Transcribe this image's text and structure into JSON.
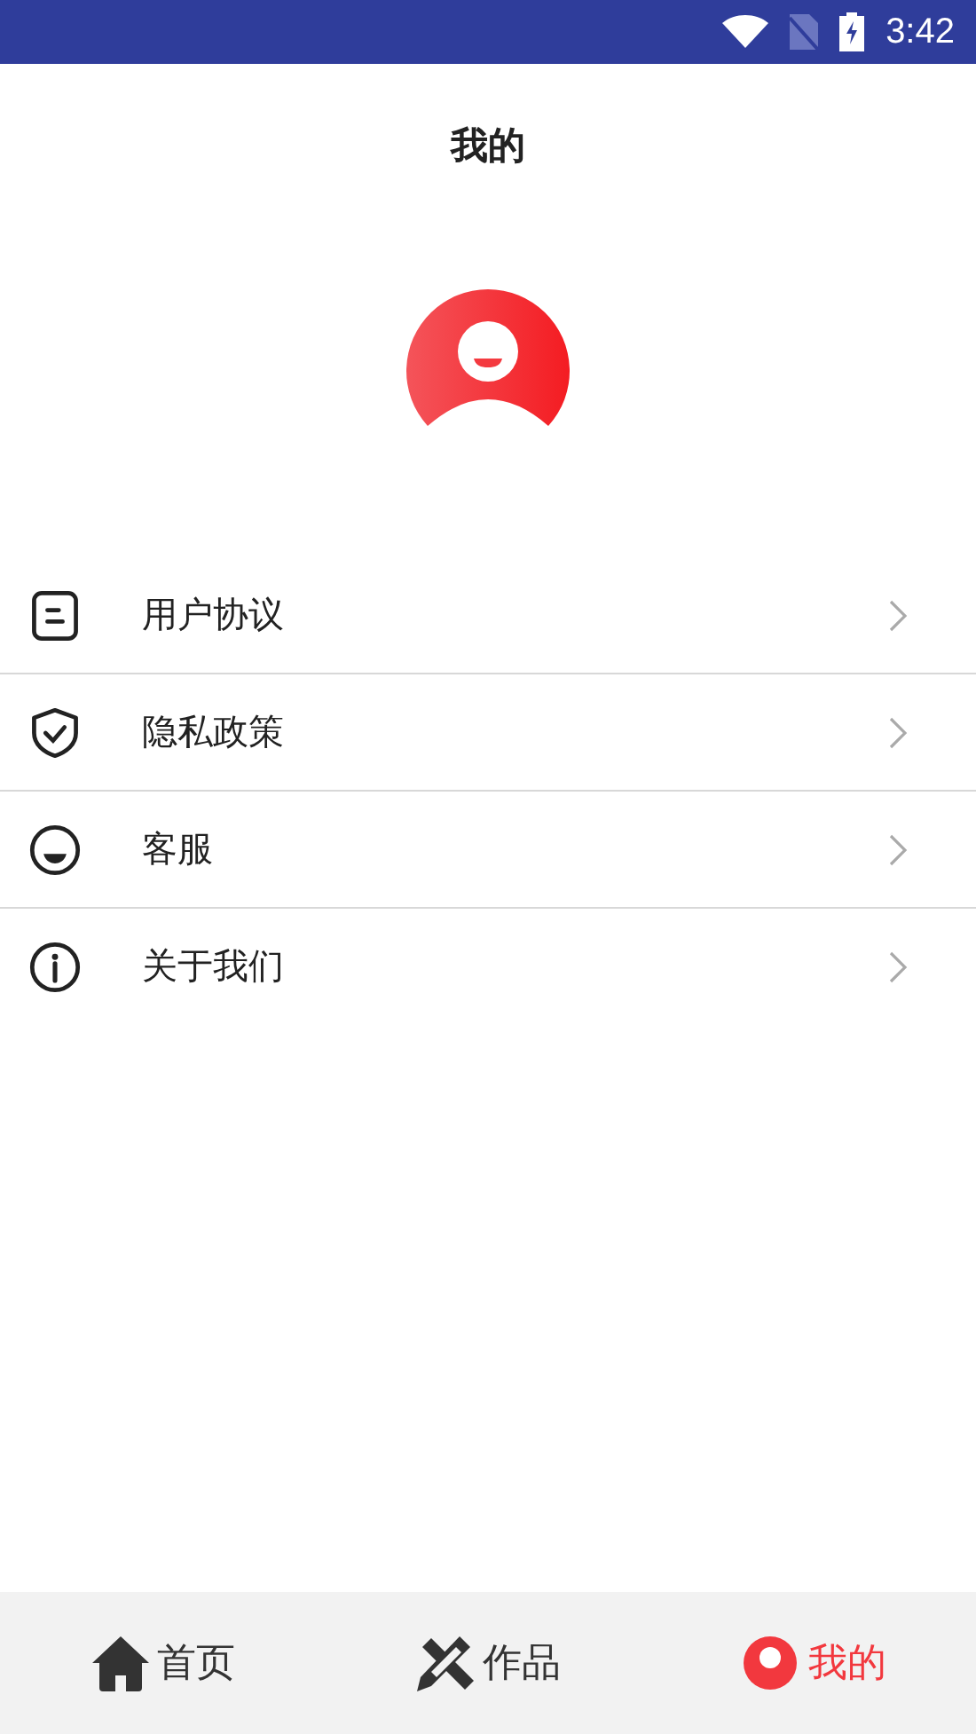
{
  "status_bar": {
    "time": "3:42"
  },
  "header": {
    "title": "我的"
  },
  "menu": [
    {
      "kind": "document",
      "label": "用户协议"
    },
    {
      "kind": "shield",
      "label": "隐私政策"
    },
    {
      "kind": "smile",
      "label": "客服"
    },
    {
      "kind": "info",
      "label": "关于我们"
    }
  ],
  "nav": [
    {
      "kind": "home",
      "label": "首页",
      "selected": false
    },
    {
      "kind": "works",
      "label": "作品",
      "selected": false
    },
    {
      "kind": "profile",
      "label": "我的",
      "selected": true
    }
  ]
}
